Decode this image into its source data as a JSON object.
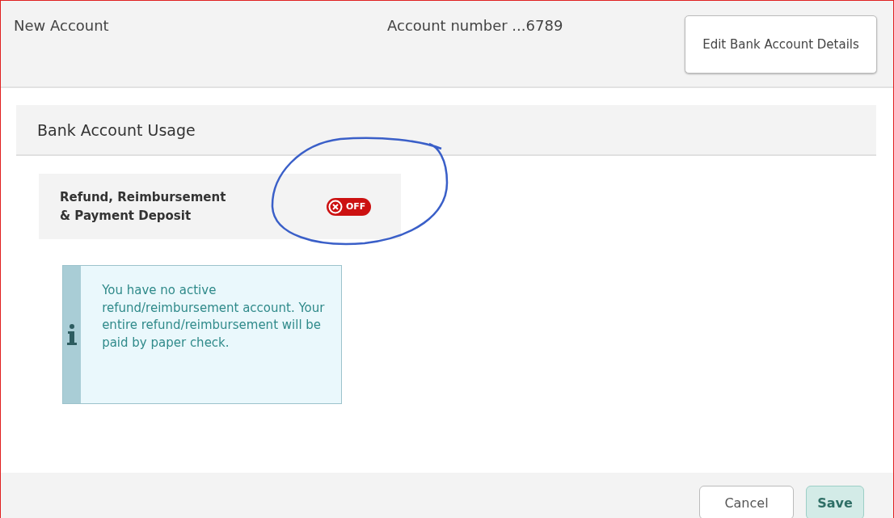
{
  "header": {
    "title": "New Account",
    "account_number": "Account number ...6789",
    "edit_button": "Edit Bank Account Details"
  },
  "section": {
    "title": "Bank Account Usage"
  },
  "setting": {
    "label_lines": [
      "Refund, Reimbursement",
      "& Payment Deposit"
    ],
    "on": false,
    "state_text": "OFF"
  },
  "info": {
    "message": "You have no active refund/reimbursement account. Your entire refund/reimbursement will be paid by paper check."
  },
  "footer": {
    "buttons": [
      {
        "label": "Cancel",
        "kind": "secondary"
      },
      {
        "label": "Save",
        "kind": "primary"
      }
    ]
  }
}
